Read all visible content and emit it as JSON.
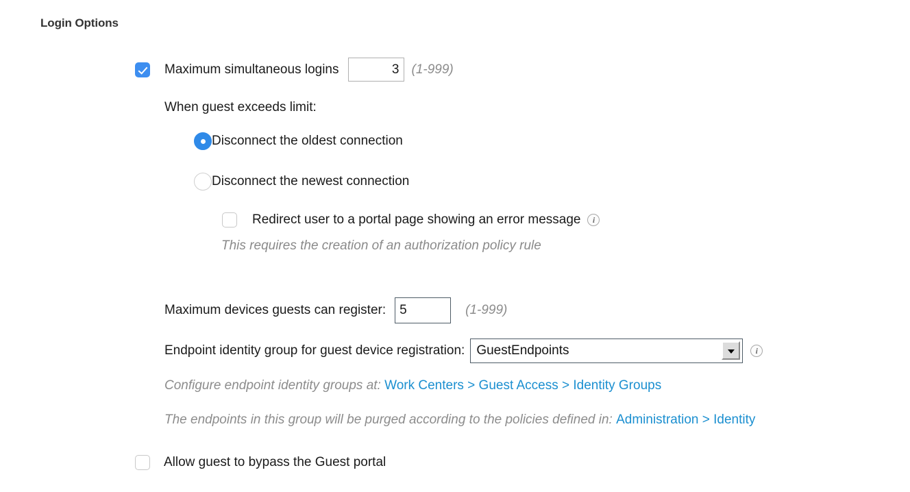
{
  "section": {
    "title": "Login Options"
  },
  "max_logins": {
    "checked": true,
    "label": "Maximum simultaneous logins",
    "value": "3",
    "range_hint": "(1-999)"
  },
  "exceeds_limit": {
    "label": "When guest exceeds limit:",
    "options": [
      {
        "label": "Disconnect the oldest connection",
        "selected": true
      },
      {
        "label": "Disconnect the newest connection",
        "selected": false
      }
    ]
  },
  "redirect": {
    "checked": false,
    "label": "Redirect user to a portal page showing an error message",
    "info_icon": "info-icon",
    "note": "This requires the creation of an authorization policy rule"
  },
  "max_devices": {
    "label": "Maximum devices guests can register:",
    "value": "5",
    "range_hint": "(1-999)"
  },
  "endpoint_group": {
    "label": "Endpoint identity group for guest device registration:",
    "selected": "GuestEndpoints",
    "info_icon": "info-icon"
  },
  "configure_hint": {
    "text": "Configure endpoint identity groups at: ",
    "link": "Work Centers > Guest Access > Identity Groups"
  },
  "purge_hint": {
    "text": "The endpoints in this group will be purged according to the policies defined in: ",
    "link": "Administration > Identity"
  },
  "bypass": {
    "checked": false,
    "label": "Allow guest to bypass the Guest portal"
  },
  "colors": {
    "accent_blue": "#3d8ef0",
    "radio_blue": "#2f8ae8",
    "link_blue": "#1b8fd0",
    "hint_gray": "#8c8c8c",
    "heading_gray": "#333333"
  }
}
